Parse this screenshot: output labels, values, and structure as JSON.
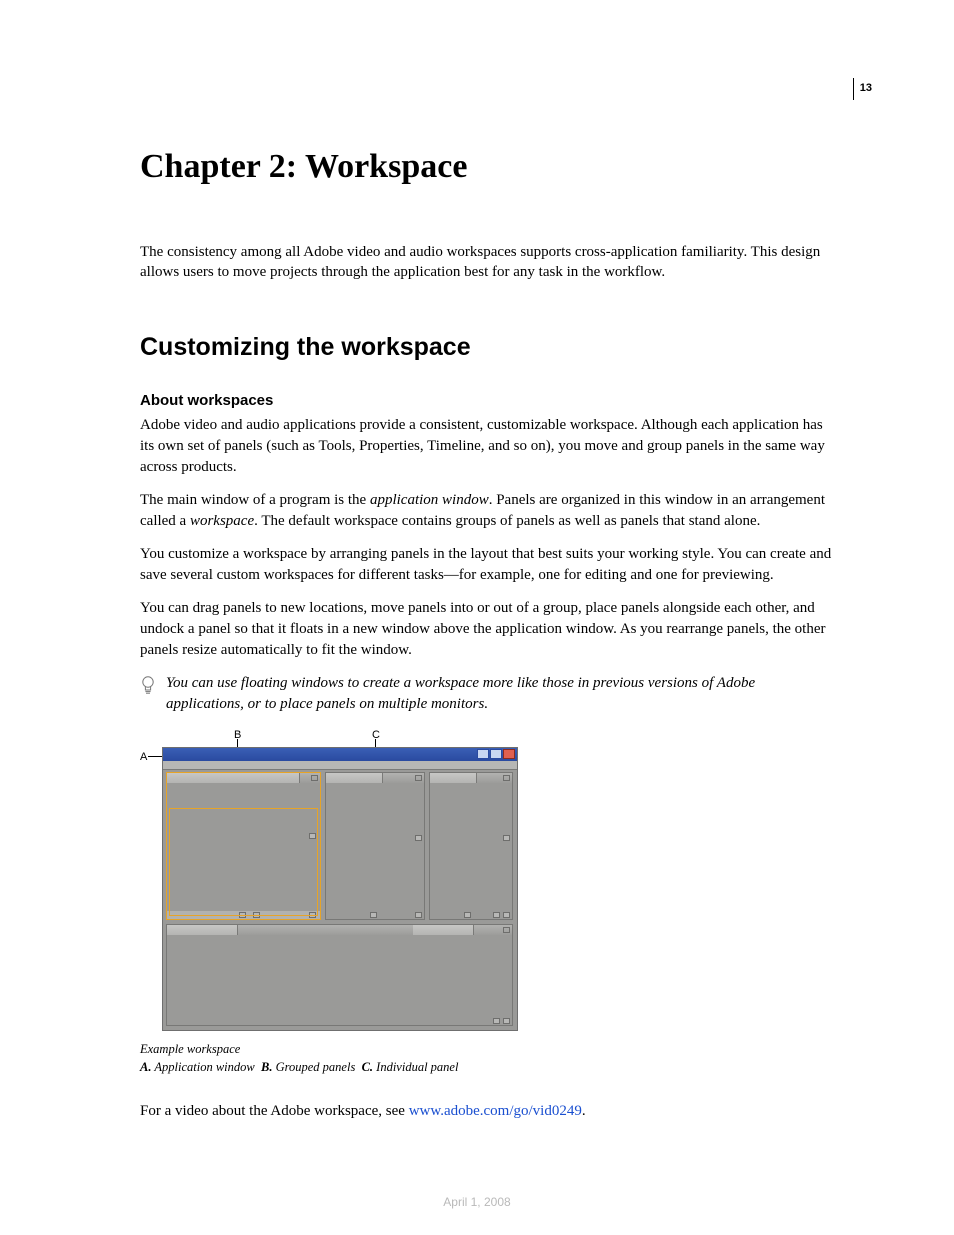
{
  "page_number": "13",
  "chapter_title": "Chapter 2: Workspace",
  "intro": "The consistency among all Adobe video and audio workspaces supports cross-application familiarity. This design allows users to move projects through the application best for any task in the workflow.",
  "section_heading": "Customizing the workspace",
  "subsection_heading": "About workspaces",
  "para1": "Adobe video and audio applications provide a consistent, customizable workspace. Although each application has its own set of panels (such as Tools, Properties, Timeline, and so on), you move and group panels in the same way across products.",
  "para2_pre": "The main window of a program is the ",
  "para2_em1": "application window",
  "para2_mid": ". Panels are organized in this window in an arrangement called a ",
  "para2_em2": "workspace",
  "para2_post": ". The default workspace contains groups of panels as well as panels that stand alone.",
  "para3": "You customize a workspace by arranging panels in the layout that best suits your working style. You can create and save several custom workspaces for different tasks—for example, one for editing and one for previewing.",
  "para4": "You can drag panels to new locations, move panels into or out of a group, place panels alongside each other, and undock a panel so that it floats in a new window above the application window. As you rearrange panels, the other panels resize automatically to fit the window.",
  "tip": "You can use floating windows to create a workspace more like those in previous versions of Adobe applications, or to place panels on multiple monitors.",
  "figure": {
    "label_A": "A",
    "label_B": "B",
    "label_C": "C",
    "caption_title": "Example workspace",
    "caption_keys": {
      "A": "A.",
      "B": "B.",
      "C": "C."
    },
    "caption_vals": {
      "A": "Application window",
      "B": "Grouped panels",
      "C": "Individual panel"
    }
  },
  "after_fig_pre": "For a video about the Adobe workspace, see ",
  "after_fig_link": "www.adobe.com/go/vid0249",
  "after_fig_post": ".",
  "footer_date": "April 1, 2008"
}
